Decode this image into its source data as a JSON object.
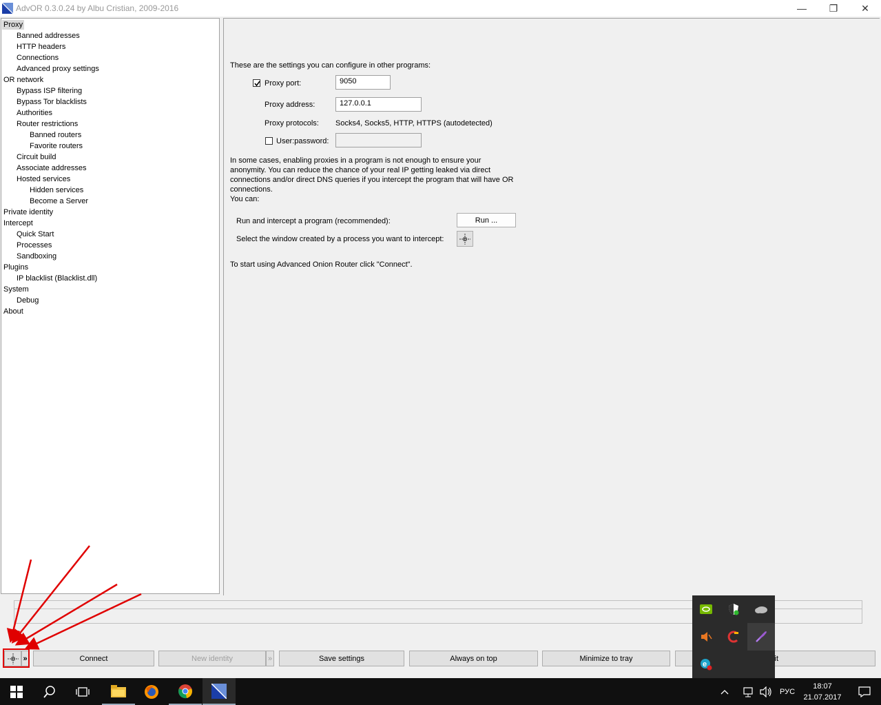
{
  "window": {
    "title": "AdvOR  0.3.0.24 by Albu Cristian, 2009-2016",
    "minimize": "—",
    "restore": "❐",
    "close": "✕"
  },
  "tree": [
    {
      "label": "Proxy",
      "level": 0,
      "selected": true
    },
    {
      "label": "Banned addresses",
      "level": 1
    },
    {
      "label": "HTTP headers",
      "level": 1
    },
    {
      "label": "Connections",
      "level": 1
    },
    {
      "label": "Advanced proxy settings",
      "level": 1
    },
    {
      "label": "OR network",
      "level": 0
    },
    {
      "label": "Bypass ISP filtering",
      "level": 1
    },
    {
      "label": "Bypass Tor blacklists",
      "level": 1
    },
    {
      "label": "Authorities",
      "level": 1
    },
    {
      "label": "Router restrictions",
      "level": 1
    },
    {
      "label": "Banned routers",
      "level": 2
    },
    {
      "label": "Favorite routers",
      "level": 2
    },
    {
      "label": "Circuit build",
      "level": 1
    },
    {
      "label": "Associate addresses",
      "level": 1
    },
    {
      "label": "Hosted services",
      "level": 1
    },
    {
      "label": "Hidden services",
      "level": 2
    },
    {
      "label": "Become a Server",
      "level": 2
    },
    {
      "label": "Private identity",
      "level": 0
    },
    {
      "label": "Intercept",
      "level": 0
    },
    {
      "label": "Quick Start",
      "level": 1
    },
    {
      "label": "Processes",
      "level": 1
    },
    {
      "label": "Sandboxing",
      "level": 1
    },
    {
      "label": "Plugins",
      "level": 0
    },
    {
      "label": "IP blacklist (Blacklist.dll)",
      "level": 1
    },
    {
      "label": "System",
      "level": 0
    },
    {
      "label": "Debug",
      "level": 1
    },
    {
      "label": "About",
      "level": 0
    }
  ],
  "content": {
    "intro": "These are the settings you can configure in other programs:",
    "proxy_port_label": "Proxy port:",
    "proxy_port_value": "9050",
    "proxy_port_checked": true,
    "proxy_address_label": "Proxy address:",
    "proxy_address_value": "127.0.0.1",
    "proxy_protocols_label": "Proxy protocols:",
    "proxy_protocols_value": "Socks4, Socks5, HTTP, HTTPS (autodetected)",
    "userpass_label": "User:password:",
    "userpass_checked": false,
    "description_lines": [
      "In some cases, enabling proxies in a program is not enough to ensure your",
      "anonymity. You can reduce the chance of your real IP getting leaked via direct",
      "connections and/or direct DNS queries if you intercept the program that will have OR",
      "connections.",
      "You can:"
    ],
    "run_label": "Run and intercept a program (recommended):",
    "run_button": "Run ...",
    "select_label": "Select the window created by a process you want to intercept:",
    "footer": "To start using Advanced Onion Router click \"Connect\"."
  },
  "bottom_buttons": {
    "expand": "»",
    "connect": "Connect",
    "new_identity": "New identity",
    "new_identity_more": "»",
    "save_settings": "Save settings",
    "always_on_top": "Always on top",
    "minimize_to_tray": "Minimize to tray",
    "exit_partial": "it"
  },
  "taskbar": {
    "language": "РУС",
    "time": "18:07",
    "date": "21.07.2017"
  },
  "colors": {
    "annotation": "#e00000",
    "taskbar": "#101010",
    "tray_popup": "#2b2b2b"
  }
}
